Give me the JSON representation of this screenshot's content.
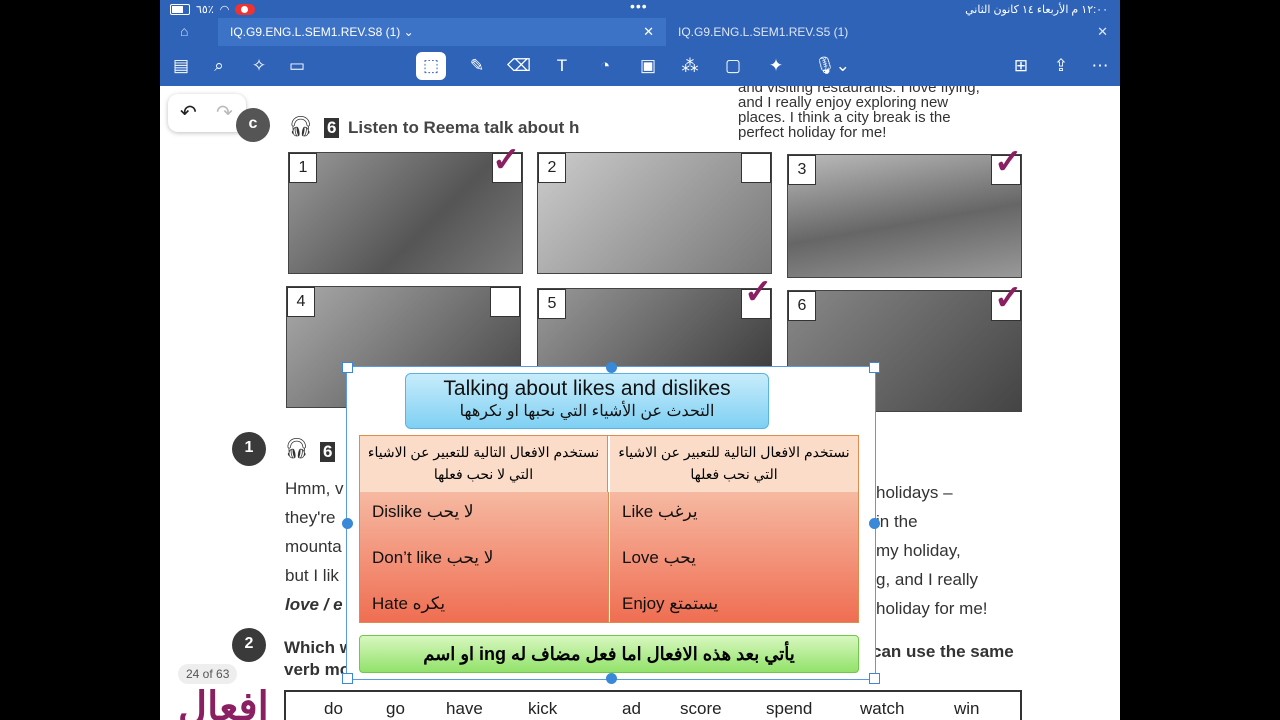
{
  "status_bar": {
    "battery": "٦٥٪",
    "datetime": "١٢:٠٠ م الأربعاء ١٤ كانون الثاني"
  },
  "tabs": [
    {
      "label": "IQ.G9.ENG.L.SEM1.REV.S8 (1)"
    },
    {
      "label": "IQ.G9.ENG.L.SEM1.REV.S5 (1)"
    }
  ],
  "page": {
    "top_text": [
      "and visiting restaurants. I love flying,",
      "and I really enjoy exploring new",
      "places. I think a city break is the",
      "perfect holiday for me!"
    ],
    "section_c": "c",
    "ex6_heading": "Listen to Reema talk about h",
    "ex6_num": "6",
    "photo_numbers": [
      "1",
      "2",
      "3",
      "4",
      "5",
      "6"
    ],
    "badge1": "1",
    "badge2": "2",
    "left_lines": [
      "Hmm, v",
      "they're",
      "mounta",
      "but I lik",
      "love / e"
    ],
    "right_lines": [
      "holidays –",
      "in the",
      "my holiday,",
      "g, and I really",
      "holiday for me!"
    ],
    "q2_left": "Which w",
    "q2_left2": "verb mo",
    "q2_right": "can use the same",
    "verbs": [
      "do",
      "go",
      "have",
      "kick",
      "ad",
      "score",
      "spend",
      "watch",
      "win"
    ],
    "page_count": "24 of 63",
    "handwriting": "افعال"
  },
  "overlay": {
    "title_en": "Talking about likes and dislikes",
    "title_ar": "التحدث عن الأشياء التي نحبها او نكرهها",
    "col_right_header": "نستخدم الافعال التالية للتعبير عن الاشياء التي نحب فعلها",
    "col_left_header": "نستخدم الافعال التالية للتعبير عن الاشياء التي لا نحب فعلها",
    "likes": [
      "Like يرغب",
      "Love يحب",
      "Enjoy يستمتع"
    ],
    "dislikes": [
      "Dislike لا يحب",
      "Don’t like لا يحب",
      "Hate يكره"
    ],
    "footer": "يأتي بعد هذه الافعال اما فعل مضاف له ing او اسم"
  }
}
